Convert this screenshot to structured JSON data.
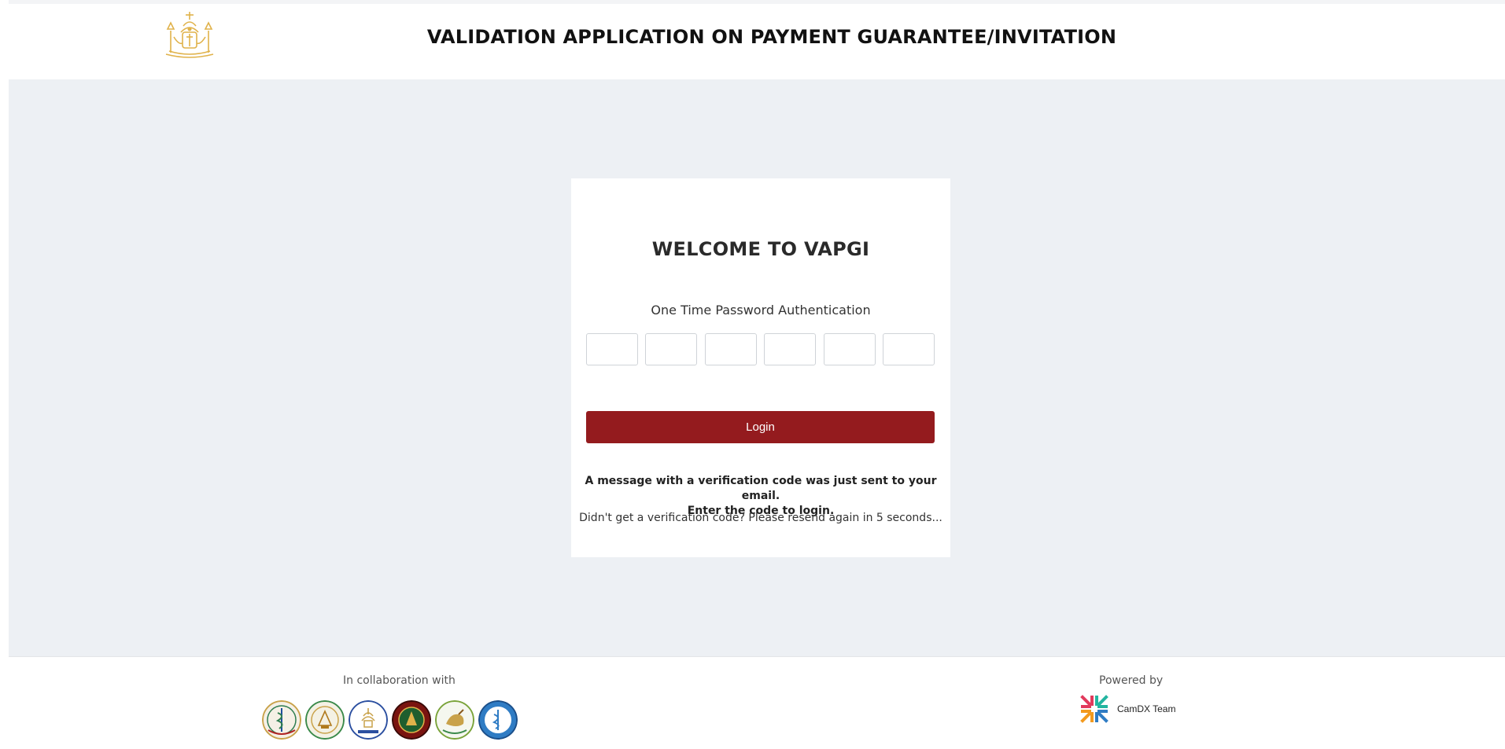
{
  "header": {
    "title": "VALIDATION APPLICATION ON PAYMENT GUARANTEE/INVITATION",
    "emblem_icon": "royal-cambodia-emblem-icon"
  },
  "card": {
    "title": "WELCOME TO VAPGI",
    "otp_label": "One Time Password Authentication",
    "otp_digits": [
      "",
      "",
      "",
      "",
      "",
      ""
    ],
    "login_label": "Login",
    "message_line1": "A message with a verification code was just sent to your email.",
    "message_line2": "Enter the code to login.",
    "resend_text": "Didn't get a verification code? Please resend again in 5 seconds..."
  },
  "footer": {
    "collab_label": "In collaboration with",
    "powered_label": "Powered by",
    "powered_name": "CamDX Team"
  },
  "colors": {
    "accent": "#941b1e",
    "background": "#edf0f4",
    "emblem_gold": "#e0b24a"
  }
}
